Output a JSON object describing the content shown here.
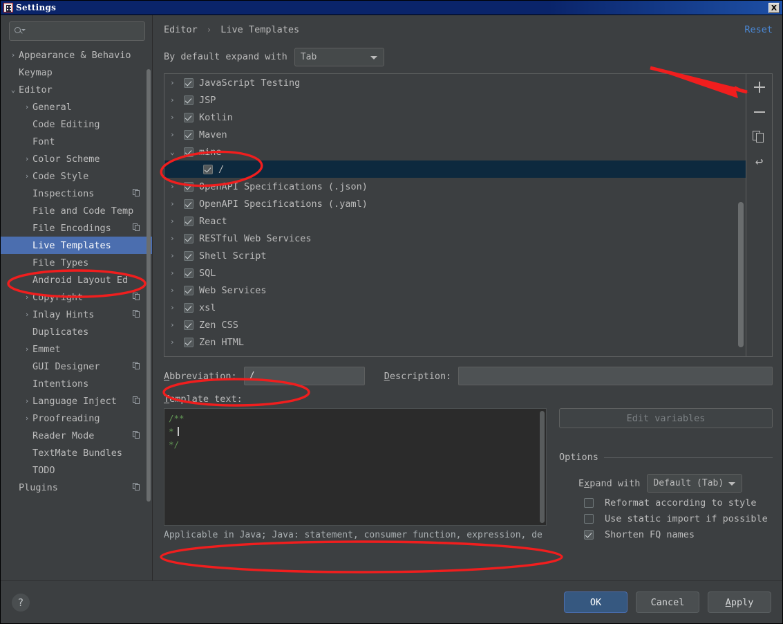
{
  "window": {
    "title": "Settings",
    "close_label": "X"
  },
  "sidebar": {
    "search_placeholder": "",
    "items": [
      {
        "label": "Appearance & Behavio",
        "arrow": "›",
        "indent": 0,
        "badge": false
      },
      {
        "label": "Keymap",
        "arrow": "",
        "indent": 0,
        "badge": false
      },
      {
        "label": "Editor",
        "arrow": "⌄",
        "indent": 0,
        "badge": false
      },
      {
        "label": "General",
        "arrow": "›",
        "indent": 1,
        "badge": false
      },
      {
        "label": "Code Editing",
        "arrow": "",
        "indent": 1,
        "badge": false
      },
      {
        "label": "Font",
        "arrow": "",
        "indent": 1,
        "badge": false
      },
      {
        "label": "Color Scheme",
        "arrow": "›",
        "indent": 1,
        "badge": false
      },
      {
        "label": "Code Style",
        "arrow": "›",
        "indent": 1,
        "badge": false
      },
      {
        "label": "Inspections",
        "arrow": "",
        "indent": 1,
        "badge": true
      },
      {
        "label": "File and Code Temp",
        "arrow": "",
        "indent": 1,
        "badge": false
      },
      {
        "label": "File Encodings",
        "arrow": "",
        "indent": 1,
        "badge": true
      },
      {
        "label": "Live Templates",
        "arrow": "",
        "indent": 1,
        "badge": false,
        "selected": true
      },
      {
        "label": "File Types",
        "arrow": "",
        "indent": 1,
        "badge": false
      },
      {
        "label": "Android Layout Ed",
        "arrow": "",
        "indent": 1,
        "badge": false
      },
      {
        "label": "Copyright",
        "arrow": "›",
        "indent": 1,
        "badge": true
      },
      {
        "label": "Inlay Hints",
        "arrow": "›",
        "indent": 1,
        "badge": true
      },
      {
        "label": "Duplicates",
        "arrow": "",
        "indent": 1,
        "badge": false
      },
      {
        "label": "Emmet",
        "arrow": "›",
        "indent": 1,
        "badge": false
      },
      {
        "label": "GUI Designer",
        "arrow": "",
        "indent": 1,
        "badge": true
      },
      {
        "label": "Intentions",
        "arrow": "",
        "indent": 1,
        "badge": false
      },
      {
        "label": "Language Inject",
        "arrow": "›",
        "indent": 1,
        "badge": true
      },
      {
        "label": "Proofreading",
        "arrow": "›",
        "indent": 1,
        "badge": false
      },
      {
        "label": "Reader Mode",
        "arrow": "",
        "indent": 1,
        "badge": true
      },
      {
        "label": "TextMate Bundles",
        "arrow": "",
        "indent": 1,
        "badge": false
      },
      {
        "label": "TODO",
        "arrow": "",
        "indent": 1,
        "badge": false
      },
      {
        "label": "Plugins",
        "arrow": "",
        "indent": 0,
        "badge": true
      }
    ]
  },
  "main": {
    "breadcrumb_root": "Editor",
    "breadcrumb_sep": "›",
    "breadcrumb_leaf": "Live Templates",
    "reset_label": "Reset",
    "expand_label": "By default expand with",
    "expand_value": "Tab",
    "toolbar": {
      "add_label": "+",
      "remove_label": "−",
      "duplicate_label": "duplicate",
      "revert_label": "↩"
    },
    "templates": [
      {
        "label": "JavaScript Testing",
        "arrow": "›",
        "checked": true,
        "child": false
      },
      {
        "label": "JSP",
        "arrow": "›",
        "checked": true,
        "child": false
      },
      {
        "label": "Kotlin",
        "arrow": "›",
        "checked": true,
        "child": false
      },
      {
        "label": "Maven",
        "arrow": "›",
        "checked": true,
        "child": false
      },
      {
        "label": "mine",
        "arrow": "⌄",
        "checked": true,
        "child": false
      },
      {
        "label": "/",
        "arrow": "",
        "checked": true,
        "child": true,
        "selected": true
      },
      {
        "label": "OpenAPI Specifications (.json)",
        "arrow": "›",
        "checked": true,
        "child": false
      },
      {
        "label": "OpenAPI Specifications (.yaml)",
        "arrow": "›",
        "checked": true,
        "child": false
      },
      {
        "label": "React",
        "arrow": "›",
        "checked": true,
        "child": false
      },
      {
        "label": "RESTful Web Services",
        "arrow": "›",
        "checked": true,
        "child": false
      },
      {
        "label": "Shell Script",
        "arrow": "›",
        "checked": true,
        "child": false
      },
      {
        "label": "SQL",
        "arrow": "›",
        "checked": true,
        "child": false
      },
      {
        "label": "Web Services",
        "arrow": "›",
        "checked": true,
        "child": false
      },
      {
        "label": "xsl",
        "arrow": "›",
        "checked": true,
        "child": false
      },
      {
        "label": "Zen CSS",
        "arrow": "›",
        "checked": true,
        "child": false
      },
      {
        "label": "Zen HTML",
        "arrow": "›",
        "checked": true,
        "child": false
      }
    ],
    "form": {
      "abbreviation_label": "Abbreviation:",
      "abbreviation_value": "/",
      "description_label": "Description:",
      "description_value": "",
      "template_text_label": "Template text:",
      "template_lines": [
        "/**",
        "*",
        "*/"
      ],
      "edit_variables_label": "Edit variables",
      "options_title": "Options",
      "expand_with_label": "Expand with",
      "expand_with_value": "Default (Tab)",
      "checkboxes": [
        {
          "label": "Reformat according to style",
          "checked": false
        },
        {
          "label": "Use static import if possible",
          "checked": false
        },
        {
          "label": "Shorten FQ names",
          "checked": true
        }
      ],
      "applicable_text": "Applicable in Java; Java: statement, consumer function, expression, de"
    }
  },
  "footer": {
    "help_label": "?",
    "ok_label": "OK",
    "cancel_label": "Cancel",
    "apply_label": "Apply"
  },
  "colors": {
    "accent_blue": "#4b6eaf",
    "annotation_red": "#f01e1e",
    "link_blue": "#4a88d6",
    "code_green": "#629755"
  }
}
